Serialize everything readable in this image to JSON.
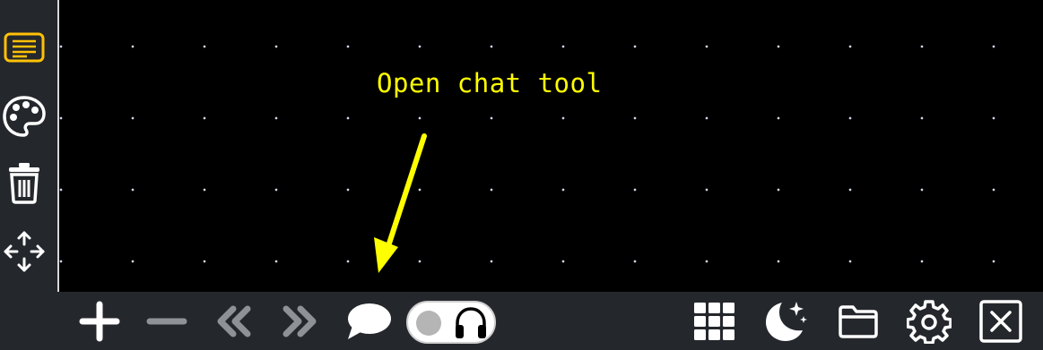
{
  "annotation": {
    "text": "Open chat tool"
  },
  "sidebar": {
    "items": [
      {
        "icon": "notes-icon",
        "active": true
      },
      {
        "icon": "palette-icon",
        "active": false
      },
      {
        "icon": "trash-icon",
        "active": false
      },
      {
        "icon": "move-arrows-icon",
        "active": false
      }
    ]
  },
  "toolbar": {
    "left": [
      "plus-icon",
      "minus-icon",
      "rewind-icon",
      "fast-forward-icon",
      "chat-bubble-icon"
    ],
    "toggle": {
      "state": "off",
      "icon": "headphones-icon"
    },
    "right": [
      "grid-icon",
      "night-mode-icon",
      "folder-icon",
      "settings-icon",
      "close-icon"
    ]
  },
  "colors": {
    "accent": "#ffc107",
    "annotation": "#ffff00",
    "toolbar_bg": "#24272c",
    "canvas_bg": "#000000",
    "disabled": "#8e9196"
  }
}
